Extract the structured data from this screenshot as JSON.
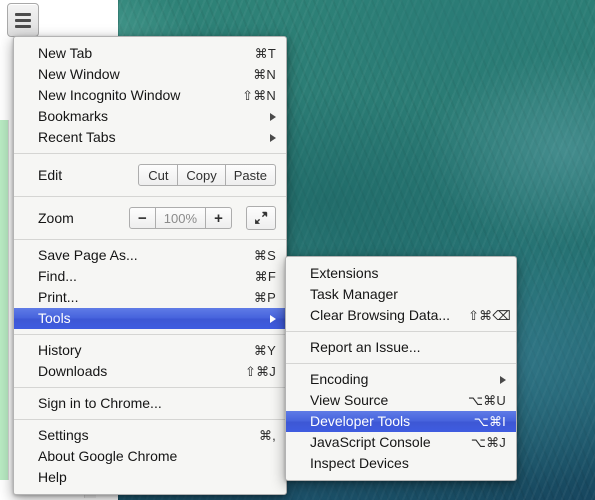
{
  "desktop": {
    "wallpaper_description": "teal ocean water texture",
    "wallpaper_color": "#2a7a70"
  },
  "toolbar": {
    "menu_button_name": "Chrome menu",
    "menu_button_icon": "hamburger-icon"
  },
  "theme": {
    "menu_background": "#f6f6f4",
    "menu_border": "#b3b3b3",
    "highlight_blue": "#4663dd",
    "highlight_text": "#ffffff",
    "text": "#151515",
    "accel_text": "#2b2b2b",
    "separator": "#d5d5d3",
    "zoom_value_text": "#8b8b8b",
    "left_strip_green": "#b8eac2"
  },
  "main_menu": {
    "groups": [
      {
        "items": [
          {
            "label": "New Tab",
            "accel": "⌘T",
            "arrow": false,
            "selected": false
          },
          {
            "label": "New Window",
            "accel": "⌘N",
            "arrow": false,
            "selected": false
          },
          {
            "label": "New Incognito Window",
            "accel": "⇧⌘N",
            "arrow": false,
            "selected": false
          },
          {
            "label": "Bookmarks",
            "accel": "",
            "arrow": true,
            "selected": false
          },
          {
            "label": "Recent Tabs",
            "accel": "",
            "arrow": true,
            "selected": false
          }
        ]
      }
    ],
    "edit_row": {
      "label": "Edit",
      "buttons": [
        {
          "label": "Cut"
        },
        {
          "label": "Copy"
        },
        {
          "label": "Paste"
        }
      ]
    },
    "zoom_row": {
      "label": "Zoom",
      "minus_label": "−",
      "value": "100%",
      "plus_label": "+",
      "fullscreen_icon": "fullscreen-arrows-icon"
    },
    "group_file": [
      {
        "label": "Save Page As...",
        "accel": "⌘S",
        "arrow": false,
        "selected": false
      },
      {
        "label": "Find...",
        "accel": "⌘F",
        "arrow": false,
        "selected": false
      },
      {
        "label": "Print...",
        "accel": "⌘P",
        "arrow": false,
        "selected": false
      },
      {
        "label": "Tools",
        "accel": "",
        "arrow": true,
        "selected": true
      }
    ],
    "group_history": [
      {
        "label": "History",
        "accel": "⌘Y",
        "arrow": false,
        "selected": false
      },
      {
        "label": "Downloads",
        "accel": "⇧⌘J",
        "arrow": false,
        "selected": false
      }
    ],
    "group_signin": [
      {
        "label": "Sign in to Chrome...",
        "accel": "",
        "arrow": false,
        "selected": false
      }
    ],
    "group_settings": [
      {
        "label": "Settings",
        "accel": "⌘,",
        "arrow": false,
        "selected": false
      },
      {
        "label": "About Google Chrome",
        "accel": "",
        "arrow": false,
        "selected": false
      },
      {
        "label": "Help",
        "accel": "",
        "arrow": false,
        "selected": false
      }
    ]
  },
  "tools_submenu": {
    "group_one": [
      {
        "label": "Extensions",
        "accel": "",
        "arrow": false,
        "selected": false
      },
      {
        "label": "Task Manager",
        "accel": "",
        "arrow": false,
        "selected": false
      },
      {
        "label": "Clear Browsing Data...",
        "accel": "⇧⌘⌫",
        "arrow": false,
        "selected": false
      }
    ],
    "group_two": [
      {
        "label": "Report an Issue...",
        "accel": "",
        "arrow": false,
        "selected": false
      }
    ],
    "group_three": [
      {
        "label": "Encoding",
        "accel": "",
        "arrow": true,
        "selected": false
      },
      {
        "label": "View Source",
        "accel": "⌥⌘U",
        "arrow": false,
        "selected": false
      },
      {
        "label": "Developer Tools",
        "accel": "⌥⌘I",
        "arrow": false,
        "selected": true
      },
      {
        "label": "JavaScript Console",
        "accel": "⌥⌘J",
        "arrow": false,
        "selected": false
      },
      {
        "label": "Inspect Devices",
        "accel": "",
        "arrow": false,
        "selected": false
      }
    ]
  }
}
